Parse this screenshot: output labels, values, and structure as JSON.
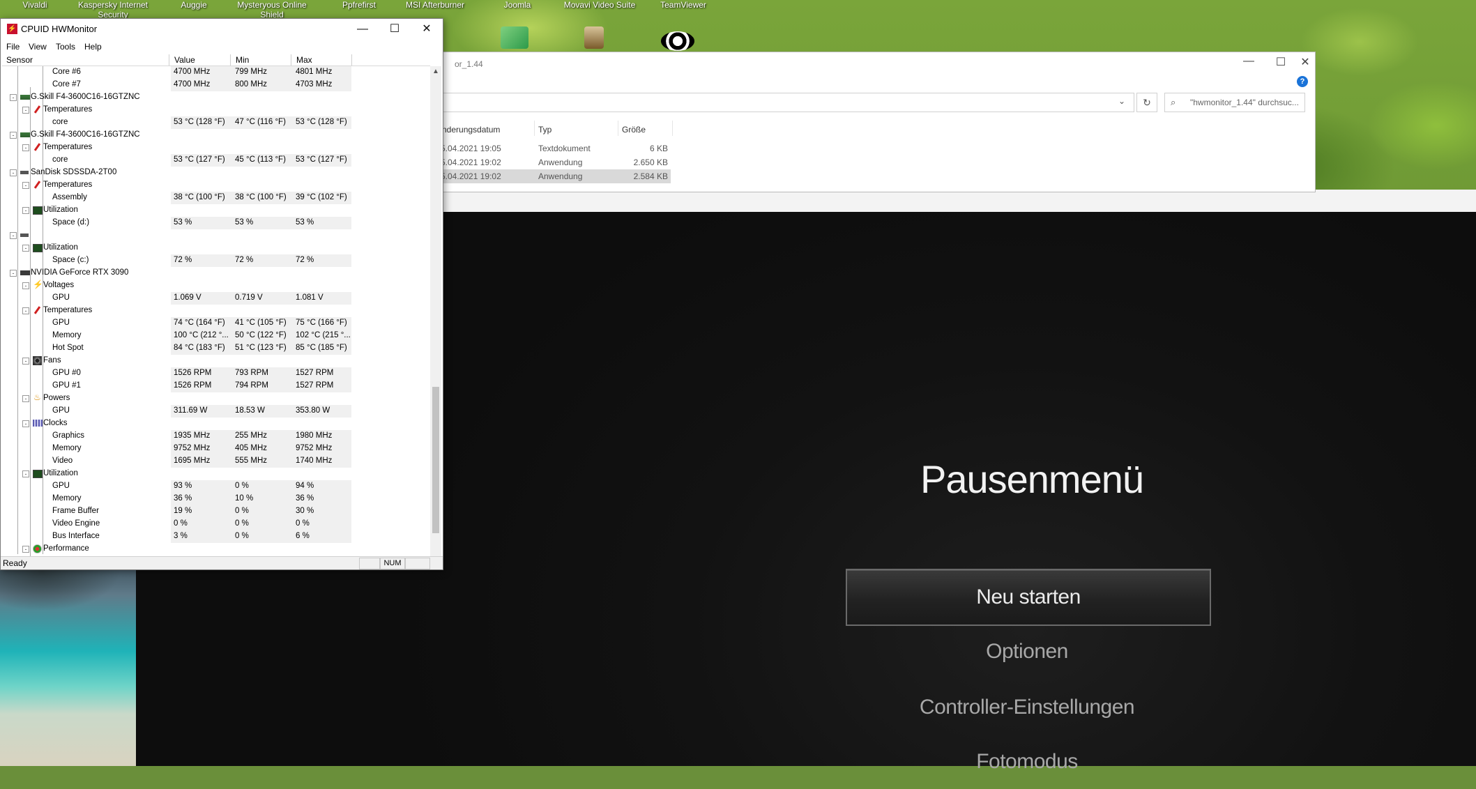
{
  "desktop": {
    "icon_labels": [
      "Vivaldi",
      "Kaspersky Internet Security",
      "Auggie",
      "Mysteryous Online Shield",
      "Ppfrefirst",
      "MSI Afterburner",
      "Joomla",
      "Movavi Video Suite",
      "TeamViewer"
    ]
  },
  "hwmonitor": {
    "title": "CPUID HWMonitor",
    "menu": [
      "File",
      "View",
      "Tools",
      "Help"
    ],
    "columns": {
      "sensor": "Sensor",
      "value": "Value",
      "min": "Min",
      "max": "Max"
    },
    "rows": [
      {
        "indent": 4,
        "label": "Core #6",
        "value": "4700 MHz",
        "min": "799 MHz",
        "max": "4801 MHz"
      },
      {
        "indent": 4,
        "label": "Core #7",
        "value": "4700 MHz",
        "min": "800 MHz",
        "max": "4703 MHz"
      },
      {
        "indent": 2,
        "toggle": "-",
        "icon": "mem",
        "label": "G.Skill F4-3600C16-16GTZNC"
      },
      {
        "indent": 3,
        "toggle": "-",
        "icon": "therm",
        "label": "Temperatures"
      },
      {
        "indent": 4,
        "label": "core",
        "value": "53 °C  (128 °F)",
        "min": "47 °C  (116 °F)",
        "max": "53 °C  (128 °F)"
      },
      {
        "indent": 2,
        "toggle": "-",
        "icon": "mem",
        "label": "G.Skill F4-3600C16-16GTZNC"
      },
      {
        "indent": 3,
        "toggle": "-",
        "icon": "therm",
        "label": "Temperatures"
      },
      {
        "indent": 4,
        "label": "core",
        "value": "53 °C  (127 °F)",
        "min": "45 °C  (113 °F)",
        "max": "53 °C  (127 °F)"
      },
      {
        "indent": 2,
        "toggle": "-",
        "icon": "ssd",
        "label": "SanDisk SDSSDA-2T00"
      },
      {
        "indent": 3,
        "toggle": "-",
        "icon": "therm",
        "label": "Temperatures"
      },
      {
        "indent": 4,
        "label": "Assembly",
        "value": "38 °C  (100 °F)",
        "min": "38 °C  (100 °F)",
        "max": "39 °C  (102 °F)"
      },
      {
        "indent": 3,
        "toggle": "-",
        "icon": "util",
        "label": "Utilization"
      },
      {
        "indent": 4,
        "label": "Space (d:)",
        "value": "53 %",
        "min": "53 %",
        "max": "53 %"
      },
      {
        "indent": 2,
        "toggle": "-",
        "icon": "ssd",
        "label": ""
      },
      {
        "indent": 3,
        "toggle": "-",
        "icon": "util",
        "label": "Utilization"
      },
      {
        "indent": 4,
        "label": "Space (c:)",
        "value": "72 %",
        "min": "72 %",
        "max": "72 %"
      },
      {
        "indent": 2,
        "toggle": "-",
        "icon": "gpu",
        "label": "NVIDIA GeForce RTX 3090"
      },
      {
        "indent": 3,
        "toggle": "-",
        "icon": "volt",
        "label": "Voltages"
      },
      {
        "indent": 4,
        "label": "GPU",
        "value": "1.069 V",
        "min": "0.719 V",
        "max": "1.081 V"
      },
      {
        "indent": 3,
        "toggle": "-",
        "icon": "therm",
        "label": "Temperatures"
      },
      {
        "indent": 4,
        "label": "GPU",
        "value": "74 °C  (164 °F)",
        "min": "41 °C  (105 °F)",
        "max": "75 °C  (166 °F)"
      },
      {
        "indent": 4,
        "label": "Memory",
        "value": "100 °C  (212 °...",
        "min": "50 °C  (122 °F)",
        "max": "102 °C  (215 °..."
      },
      {
        "indent": 4,
        "label": "Hot Spot",
        "value": "84 °C  (183 °F)",
        "min": "51 °C  (123 °F)",
        "max": "85 °C  (185 °F)"
      },
      {
        "indent": 3,
        "toggle": "-",
        "icon": "fan",
        "label": "Fans"
      },
      {
        "indent": 4,
        "label": "GPU #0",
        "value": "1526 RPM",
        "min": "793 RPM",
        "max": "1527 RPM"
      },
      {
        "indent": 4,
        "label": "GPU #1",
        "value": "1526 RPM",
        "min": "794 RPM",
        "max": "1527 RPM"
      },
      {
        "indent": 3,
        "toggle": "-",
        "icon": "pow",
        "label": "Powers"
      },
      {
        "indent": 4,
        "label": "GPU",
        "value": "311.69 W",
        "min": "18.53 W",
        "max": "353.80 W"
      },
      {
        "indent": 3,
        "toggle": "-",
        "icon": "clk",
        "label": "Clocks"
      },
      {
        "indent": 4,
        "label": "Graphics",
        "value": "1935 MHz",
        "min": "255 MHz",
        "max": "1980 MHz"
      },
      {
        "indent": 4,
        "label": "Memory",
        "value": "9752 MHz",
        "min": "405 MHz",
        "max": "9752 MHz"
      },
      {
        "indent": 4,
        "label": "Video",
        "value": "1695 MHz",
        "min": "555 MHz",
        "max": "1740 MHz"
      },
      {
        "indent": 3,
        "toggle": "-",
        "icon": "util",
        "label": "Utilization"
      },
      {
        "indent": 4,
        "label": "GPU",
        "value": "93 %",
        "min": "0 %",
        "max": "94 %"
      },
      {
        "indent": 4,
        "label": "Memory",
        "value": "36 %",
        "min": "10 %",
        "max": "36 %"
      },
      {
        "indent": 4,
        "label": "Frame Buffer",
        "value": "19 %",
        "min": "0 %",
        "max": "30 %"
      },
      {
        "indent": 4,
        "label": "Video Engine",
        "value": "0 %",
        "min": "0 %",
        "max": "0 %"
      },
      {
        "indent": 4,
        "label": "Bus Interface",
        "value": "3 %",
        "min": "0 %",
        "max": "6 %"
      },
      {
        "indent": 3,
        "toggle": "-",
        "icon": "perf",
        "label": "Performance"
      }
    ],
    "status": {
      "text": "Ready",
      "num": "NUM"
    }
  },
  "explorer": {
    "title_fragment": "or_1.44",
    "search_placeholder": "\"hwmonitor_1.44\" durchsuc...",
    "columns": {
      "date": "nderungsdatum",
      "type": "Typ",
      "size": "Größe"
    },
    "rows": [
      {
        "date": "5.04.2021 19:05",
        "type": "Textdokument",
        "size": "6 KB"
      },
      {
        "date": "5.04.2021 19:02",
        "type": "Anwendung",
        "size": "2.650 KB"
      },
      {
        "date": "5.04.2021 19:02",
        "type": "Anwendung",
        "size": "2.584 KB"
      }
    ]
  },
  "game": {
    "pause_title": "Pausenmenü",
    "menu": [
      "Neu starten",
      "Optionen",
      "Controller-Einstellungen",
      "Fotomodus"
    ],
    "selected_index": 0
  }
}
